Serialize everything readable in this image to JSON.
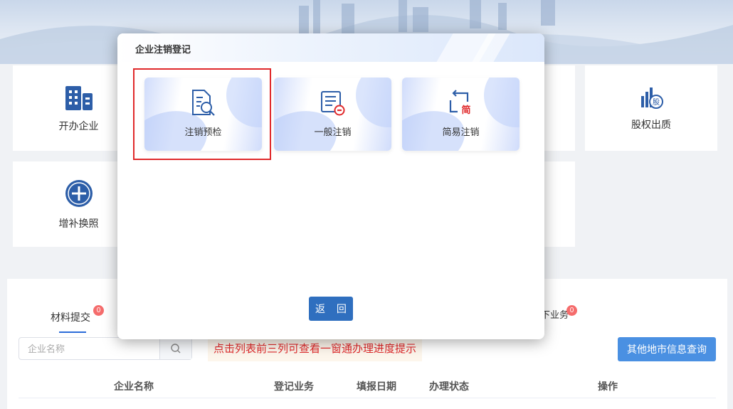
{
  "background_cards": [
    {
      "label": "开办企业",
      "icon": "building-icon"
    },
    {
      "label": "股权出质",
      "icon": "equity-chart-icon"
    },
    {
      "label": "增补换照",
      "icon": "plus-circle-icon"
    }
  ],
  "tabs": [
    {
      "label": "材料提交",
      "count": "0"
    },
    {
      "label": "下业务",
      "count": "0"
    }
  ],
  "search": {
    "placeholder": "企业名称"
  },
  "hint": "点击列表前三列可查看一窗通办理进度提示",
  "other_button": "其他地市信息查询",
  "table_headers": [
    "企业名称",
    "登记业务",
    "填报日期",
    "办理状态",
    "操作"
  ],
  "modal": {
    "title": "企业注销登记",
    "options": [
      {
        "label": "注销预检",
        "icon": "document-search-icon",
        "selected": true
      },
      {
        "label": "一般注销",
        "icon": "document-minus-icon",
        "selected": false
      },
      {
        "label": "简易注销",
        "icon": "simplified-return-icon",
        "selected": false
      }
    ],
    "back_label": "返 回"
  },
  "colors": {
    "primary": "#2f6fbf",
    "accent_blue": "#4a90e2",
    "highlight_red": "#e0292b",
    "badge": "#f56c6c"
  }
}
